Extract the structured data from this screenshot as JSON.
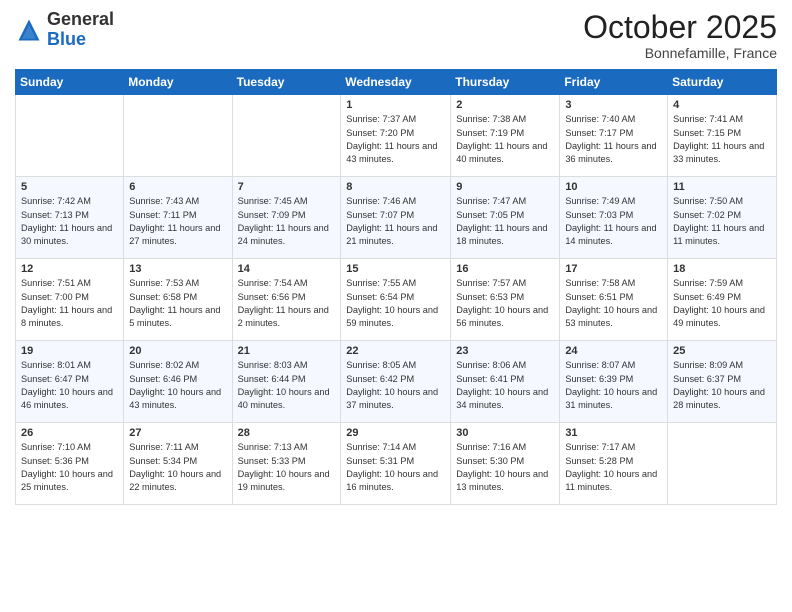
{
  "header": {
    "logo_general": "General",
    "logo_blue": "Blue",
    "month": "October 2025",
    "location": "Bonnefamille, France"
  },
  "weekdays": [
    "Sunday",
    "Monday",
    "Tuesday",
    "Wednesday",
    "Thursday",
    "Friday",
    "Saturday"
  ],
  "weeks": [
    [
      {
        "day": "",
        "sunrise": "",
        "sunset": "",
        "daylight": ""
      },
      {
        "day": "",
        "sunrise": "",
        "sunset": "",
        "daylight": ""
      },
      {
        "day": "",
        "sunrise": "",
        "sunset": "",
        "daylight": ""
      },
      {
        "day": "1",
        "sunrise": "Sunrise: 7:37 AM",
        "sunset": "Sunset: 7:20 PM",
        "daylight": "Daylight: 11 hours and 43 minutes."
      },
      {
        "day": "2",
        "sunrise": "Sunrise: 7:38 AM",
        "sunset": "Sunset: 7:19 PM",
        "daylight": "Daylight: 11 hours and 40 minutes."
      },
      {
        "day": "3",
        "sunrise": "Sunrise: 7:40 AM",
        "sunset": "Sunset: 7:17 PM",
        "daylight": "Daylight: 11 hours and 36 minutes."
      },
      {
        "day": "4",
        "sunrise": "Sunrise: 7:41 AM",
        "sunset": "Sunset: 7:15 PM",
        "daylight": "Daylight: 11 hours and 33 minutes."
      }
    ],
    [
      {
        "day": "5",
        "sunrise": "Sunrise: 7:42 AM",
        "sunset": "Sunset: 7:13 PM",
        "daylight": "Daylight: 11 hours and 30 minutes."
      },
      {
        "day": "6",
        "sunrise": "Sunrise: 7:43 AM",
        "sunset": "Sunset: 7:11 PM",
        "daylight": "Daylight: 11 hours and 27 minutes."
      },
      {
        "day": "7",
        "sunrise": "Sunrise: 7:45 AM",
        "sunset": "Sunset: 7:09 PM",
        "daylight": "Daylight: 11 hours and 24 minutes."
      },
      {
        "day": "8",
        "sunrise": "Sunrise: 7:46 AM",
        "sunset": "Sunset: 7:07 PM",
        "daylight": "Daylight: 11 hours and 21 minutes."
      },
      {
        "day": "9",
        "sunrise": "Sunrise: 7:47 AM",
        "sunset": "Sunset: 7:05 PM",
        "daylight": "Daylight: 11 hours and 18 minutes."
      },
      {
        "day": "10",
        "sunrise": "Sunrise: 7:49 AM",
        "sunset": "Sunset: 7:03 PM",
        "daylight": "Daylight: 11 hours and 14 minutes."
      },
      {
        "day": "11",
        "sunrise": "Sunrise: 7:50 AM",
        "sunset": "Sunset: 7:02 PM",
        "daylight": "Daylight: 11 hours and 11 minutes."
      }
    ],
    [
      {
        "day": "12",
        "sunrise": "Sunrise: 7:51 AM",
        "sunset": "Sunset: 7:00 PM",
        "daylight": "Daylight: 11 hours and 8 minutes."
      },
      {
        "day": "13",
        "sunrise": "Sunrise: 7:53 AM",
        "sunset": "Sunset: 6:58 PM",
        "daylight": "Daylight: 11 hours and 5 minutes."
      },
      {
        "day": "14",
        "sunrise": "Sunrise: 7:54 AM",
        "sunset": "Sunset: 6:56 PM",
        "daylight": "Daylight: 11 hours and 2 minutes."
      },
      {
        "day": "15",
        "sunrise": "Sunrise: 7:55 AM",
        "sunset": "Sunset: 6:54 PM",
        "daylight": "Daylight: 10 hours and 59 minutes."
      },
      {
        "day": "16",
        "sunrise": "Sunrise: 7:57 AM",
        "sunset": "Sunset: 6:53 PM",
        "daylight": "Daylight: 10 hours and 56 minutes."
      },
      {
        "day": "17",
        "sunrise": "Sunrise: 7:58 AM",
        "sunset": "Sunset: 6:51 PM",
        "daylight": "Daylight: 10 hours and 53 minutes."
      },
      {
        "day": "18",
        "sunrise": "Sunrise: 7:59 AM",
        "sunset": "Sunset: 6:49 PM",
        "daylight": "Daylight: 10 hours and 49 minutes."
      }
    ],
    [
      {
        "day": "19",
        "sunrise": "Sunrise: 8:01 AM",
        "sunset": "Sunset: 6:47 PM",
        "daylight": "Daylight: 10 hours and 46 minutes."
      },
      {
        "day": "20",
        "sunrise": "Sunrise: 8:02 AM",
        "sunset": "Sunset: 6:46 PM",
        "daylight": "Daylight: 10 hours and 43 minutes."
      },
      {
        "day": "21",
        "sunrise": "Sunrise: 8:03 AM",
        "sunset": "Sunset: 6:44 PM",
        "daylight": "Daylight: 10 hours and 40 minutes."
      },
      {
        "day": "22",
        "sunrise": "Sunrise: 8:05 AM",
        "sunset": "Sunset: 6:42 PM",
        "daylight": "Daylight: 10 hours and 37 minutes."
      },
      {
        "day": "23",
        "sunrise": "Sunrise: 8:06 AM",
        "sunset": "Sunset: 6:41 PM",
        "daylight": "Daylight: 10 hours and 34 minutes."
      },
      {
        "day": "24",
        "sunrise": "Sunrise: 8:07 AM",
        "sunset": "Sunset: 6:39 PM",
        "daylight": "Daylight: 10 hours and 31 minutes."
      },
      {
        "day": "25",
        "sunrise": "Sunrise: 8:09 AM",
        "sunset": "Sunset: 6:37 PM",
        "daylight": "Daylight: 10 hours and 28 minutes."
      }
    ],
    [
      {
        "day": "26",
        "sunrise": "Sunrise: 7:10 AM",
        "sunset": "Sunset: 5:36 PM",
        "daylight": "Daylight: 10 hours and 25 minutes."
      },
      {
        "day": "27",
        "sunrise": "Sunrise: 7:11 AM",
        "sunset": "Sunset: 5:34 PM",
        "daylight": "Daylight: 10 hours and 22 minutes."
      },
      {
        "day": "28",
        "sunrise": "Sunrise: 7:13 AM",
        "sunset": "Sunset: 5:33 PM",
        "daylight": "Daylight: 10 hours and 19 minutes."
      },
      {
        "day": "29",
        "sunrise": "Sunrise: 7:14 AM",
        "sunset": "Sunset: 5:31 PM",
        "daylight": "Daylight: 10 hours and 16 minutes."
      },
      {
        "day": "30",
        "sunrise": "Sunrise: 7:16 AM",
        "sunset": "Sunset: 5:30 PM",
        "daylight": "Daylight: 10 hours and 13 minutes."
      },
      {
        "day": "31",
        "sunrise": "Sunrise: 7:17 AM",
        "sunset": "Sunset: 5:28 PM",
        "daylight": "Daylight: 10 hours and 11 minutes."
      },
      {
        "day": "",
        "sunrise": "",
        "sunset": "",
        "daylight": ""
      }
    ]
  ]
}
